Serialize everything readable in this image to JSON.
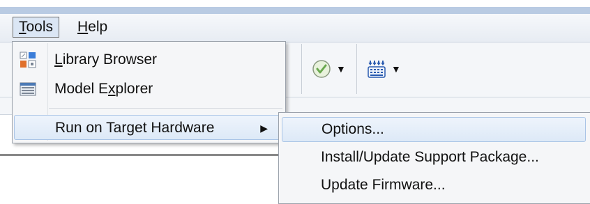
{
  "menubar": {
    "tools_label_first": "T",
    "tools_label_rest": "ools",
    "help_label_first": "H",
    "help_label_rest": "elp"
  },
  "toolbar": {
    "check_icon": "check-circle-icon",
    "keyboard_icon": "hardware-grid-icon"
  },
  "tools_menu": {
    "items": [
      {
        "pre": "",
        "ul": "L",
        "post": "ibrary Browser",
        "icon": "library-browser-icon"
      },
      {
        "pre": "Model E",
        "ul": "x",
        "post": "plorer",
        "icon": "model-explorer-icon"
      },
      {
        "pre": "",
        "ul": "",
        "post": "Run on Target Hardware",
        "icon": ""
      }
    ]
  },
  "submenu": {
    "items": [
      {
        "label": "Options..."
      },
      {
        "label": "Install/Update Support Package..."
      },
      {
        "label": "Update Firmware..."
      }
    ]
  },
  "colors": {
    "hover_bg": "#dde9f7",
    "hover_border": "#a9c4e6",
    "check_green": "#6aa84f"
  }
}
